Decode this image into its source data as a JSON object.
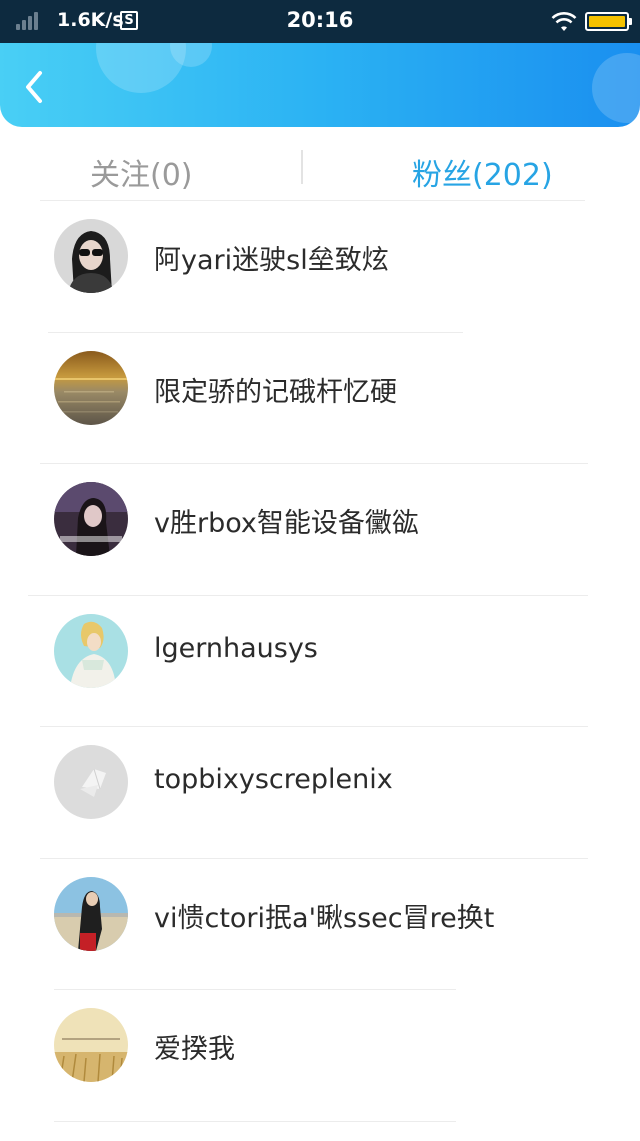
{
  "status_bar": {
    "speed": "1.6K/s",
    "s_badge": "S",
    "time": "20:16",
    "battery_color": "#f5c200"
  },
  "header": {
    "back_icon": "chevron-left-icon",
    "gradient": [
      "#49cff5",
      "#1a8ff0"
    ]
  },
  "tabs": [
    {
      "label": "关注(0)",
      "active": false,
      "color": "#9a9a9a"
    },
    {
      "label": "粉丝(202)",
      "active": true,
      "color": "#27a4e4"
    }
  ],
  "fans": [
    {
      "name": "阿yari迷驶sl垒致炫"
    },
    {
      "name": "限定骄的记硪杆忆硬"
    },
    {
      "name": "v胜rbox智能设备黴谹"
    },
    {
      "name": "lgernhausys"
    },
    {
      "name": "topbixyscreplenix"
    },
    {
      "name": "vi愦ctori抿a'瞅ssec冒re换t"
    },
    {
      "name": "爱揆我"
    }
  ]
}
